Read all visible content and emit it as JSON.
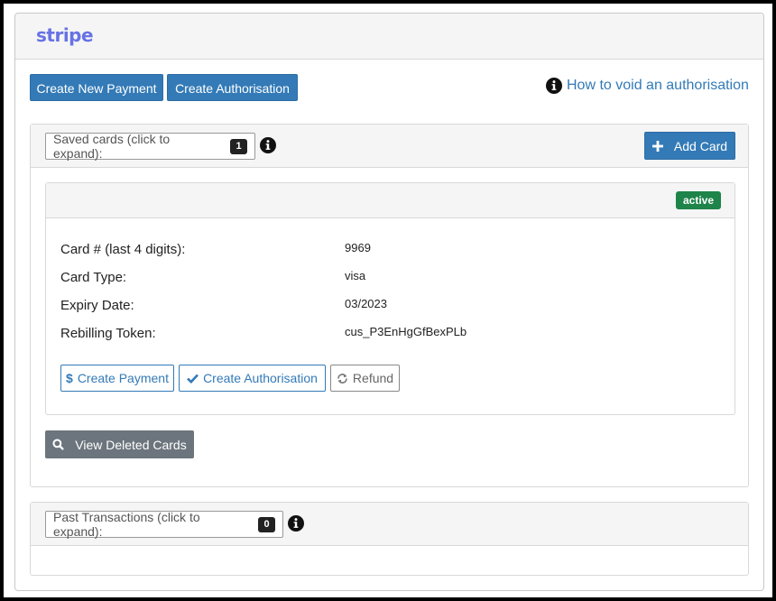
{
  "brand": {
    "logo_text": "stripe",
    "color": "#6772e5"
  },
  "toolbar": {
    "create_new_payment_label": "Create New Payment",
    "create_authorisation_label": "Create Authorisation",
    "help_link_label": "How to void an authorisation",
    "help_icon": "info-circle-icon"
  },
  "saved_cards": {
    "expander_label": "Saved cards (click to expand):",
    "count": "1",
    "add_card_label": "Add Card",
    "add_icon": "plus-icon",
    "cards": [
      {
        "status": "active",
        "status_color": "#1e8449",
        "fields": [
          {
            "label": "Card # (last 4 digits):",
            "value": "9969"
          },
          {
            "label": "Card Type:",
            "value": "visa"
          },
          {
            "label": "Expiry Date:",
            "value": "03/2023"
          },
          {
            "label": "Rebilling Token:",
            "value": "cus_P3EnHgGfBexPLb"
          }
        ],
        "actions": {
          "create_payment_label": "Create Payment",
          "create_authorisation_label": "Create Authorisation",
          "refund_label": "Refund"
        }
      }
    ],
    "view_deleted_label": "View Deleted Cards"
  },
  "past_transactions": {
    "expander_label": "Past Transactions (click to expand):",
    "count": "0"
  },
  "colors": {
    "primary": "#337ab7",
    "secondary": "#6c757d",
    "success": "#1e8449"
  }
}
